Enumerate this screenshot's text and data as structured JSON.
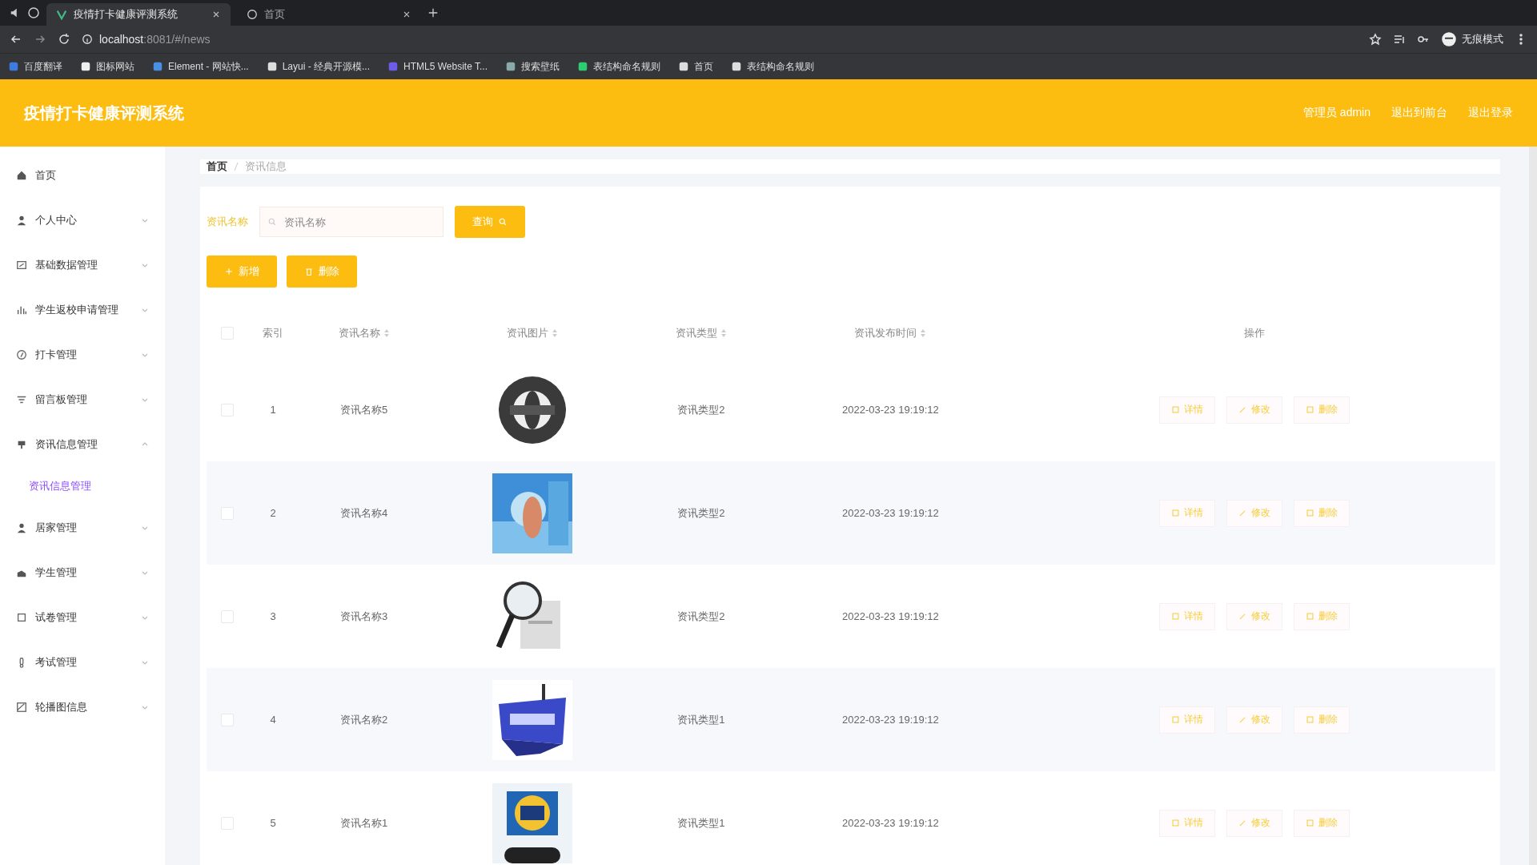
{
  "browser": {
    "tabs": [
      {
        "title": "疫情打卡健康评测系统",
        "selected": true
      },
      {
        "title": "首页",
        "selected": false
      }
    ],
    "address": {
      "host": "localhost",
      "path": ":8081/#/news"
    },
    "profile": "无痕模式",
    "bookmarks": [
      "百度翻译",
      "图标网站",
      "Element - 网站快...",
      "Layui - 经典开源模...",
      "HTML5 Website T...",
      "搜索壁纸",
      "表结构命名规则",
      "首页",
      "表结构命名规则"
    ]
  },
  "header": {
    "title": "疫情打卡健康评测系统",
    "user": "管理员 admin",
    "links": [
      "退出到前台",
      "退出登录"
    ]
  },
  "sidebar": {
    "items": [
      {
        "label": "首页"
      },
      {
        "label": "个人中心"
      },
      {
        "label": "基础数据管理"
      },
      {
        "label": "学生返校申请管理"
      },
      {
        "label": "打卡管理"
      },
      {
        "label": "留言板管理"
      },
      {
        "label": "资讯信息管理",
        "children": [
          {
            "label": "资讯信息管理",
            "selected": true
          }
        ]
      },
      {
        "label": "居家管理"
      },
      {
        "label": "学生管理"
      },
      {
        "label": "试卷管理"
      },
      {
        "label": "考试管理"
      },
      {
        "label": "轮播图信息"
      }
    ]
  },
  "breadcrumb": [
    "首页",
    "资讯信息"
  ],
  "search": {
    "label": "资讯名称",
    "placeholder": "资讯名称",
    "button": "查询"
  },
  "toolbar": [
    "新增",
    "删除"
  ],
  "table": {
    "select_all": false,
    "columns": [
      {
        "label": "索引",
        "sortable": false
      },
      {
        "label": "资讯名称",
        "sortable": true
      },
      {
        "label": "资讯图片",
        "sortable": true
      },
      {
        "label": "资讯类型",
        "sortable": true
      },
      {
        "label": "资讯发布时间",
        "sortable": true
      },
      {
        "label": "操作",
        "sortable": false
      }
    ],
    "rows": [
      {
        "checked": false,
        "index": "1",
        "name": "资讯名称5",
        "type": "资讯类型2",
        "time": "2022-03-23 19:19:12",
        "actions": [
          "详情",
          "修改",
          "删除"
        ]
      },
      {
        "checked": false,
        "index": "2",
        "name": "资讯名称4",
        "type": "资讯类型2",
        "time": "2022-03-23 19:19:12",
        "actions": [
          "详情",
          "修改",
          "删除"
        ]
      },
      {
        "checked": false,
        "index": "3",
        "name": "资讯名称3",
        "type": "资讯类型2",
        "time": "2022-03-23 19:19:12",
        "actions": [
          "详情",
          "修改",
          "删除"
        ]
      },
      {
        "checked": false,
        "index": "4",
        "name": "资讯名称2",
        "type": "资讯类型1",
        "time": "2022-03-23 19:19:12",
        "actions": [
          "详情",
          "修改",
          "删除"
        ]
      },
      {
        "checked": false,
        "index": "5",
        "name": "资讯名称1",
        "type": "资讯类型1",
        "time": "2022-03-23 19:19:12",
        "actions": [
          "详情",
          "修改",
          "删除"
        ]
      }
    ]
  }
}
